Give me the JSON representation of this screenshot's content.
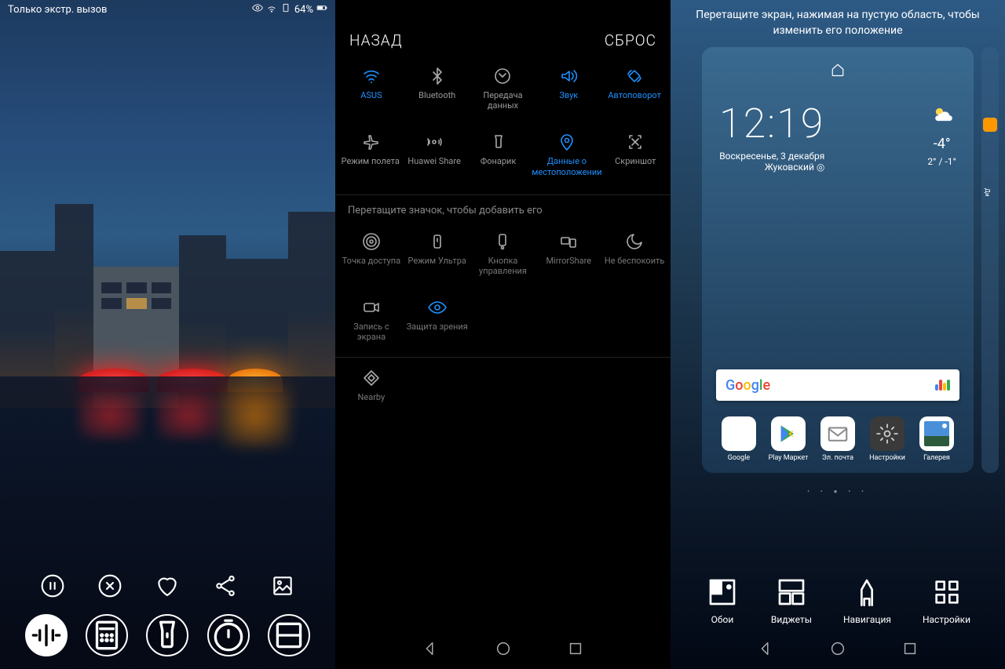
{
  "panel1": {
    "status_text": "Только экстр. вызов",
    "battery": "64%"
  },
  "panel2": {
    "back": "НАЗАД",
    "reset": "СБРОС",
    "row1": [
      {
        "label": "ASUS",
        "icon": "wifi",
        "on": true
      },
      {
        "label": "Bluetooth",
        "icon": "bluetooth",
        "on": false
      },
      {
        "label": "Передача данных",
        "icon": "data",
        "on": false
      },
      {
        "label": "Звук",
        "icon": "sound",
        "on": true
      },
      {
        "label": "Автоповорот",
        "icon": "rotate",
        "on": true
      }
    ],
    "row2": [
      {
        "label": "Режим полета",
        "icon": "airplane",
        "on": false
      },
      {
        "label": "Huawei Share",
        "icon": "share",
        "on": false
      },
      {
        "label": "Фонарик",
        "icon": "flashlight",
        "on": false
      },
      {
        "label": "Данные о местоположении",
        "icon": "location",
        "on": true
      },
      {
        "label": "Скриншот",
        "icon": "screenshot",
        "on": false
      }
    ],
    "hint": "Перетащите значок, чтобы добавить его",
    "row3": [
      {
        "label": "Точка доступа",
        "icon": "hotspot"
      },
      {
        "label": "Режим Ультра",
        "icon": "ultra"
      },
      {
        "label": "Кнопка управления",
        "icon": "navball"
      },
      {
        "label": "MirrorShare",
        "icon": "mirror"
      },
      {
        "label": "Не беспокоить",
        "icon": "dnd"
      }
    ],
    "row4": [
      {
        "label": "Запись с экрана",
        "icon": "record"
      },
      {
        "label": "Защита зрения",
        "icon": "eyecare",
        "on": true
      }
    ],
    "row5": [
      {
        "label": "Nearby",
        "icon": "nearby"
      }
    ]
  },
  "panel3": {
    "hint": "Перетащите экран, нажимая на пустую область, чтобы изменить его положение",
    "time": "12:19",
    "date_line1": "Воскресенье, 3 декабря",
    "city": "Жуковский",
    "temp": "-4°",
    "temp_range": "2° / -1°",
    "side_label": "Ди...те",
    "search_brand": "Google",
    "apps": [
      {
        "label": "Google",
        "color": "#fff"
      },
      {
        "label": "Play Маркет",
        "color": "#fff"
      },
      {
        "label": "Эл. почта",
        "color": "#fff"
      },
      {
        "label": "Настройки",
        "color": "#3a3a3a"
      },
      {
        "label": "Галерея",
        "color": "#fff"
      }
    ],
    "bar": [
      {
        "label": "Обои"
      },
      {
        "label": "Виджеты"
      },
      {
        "label": "Навигация"
      },
      {
        "label": "Настройки"
      }
    ]
  }
}
